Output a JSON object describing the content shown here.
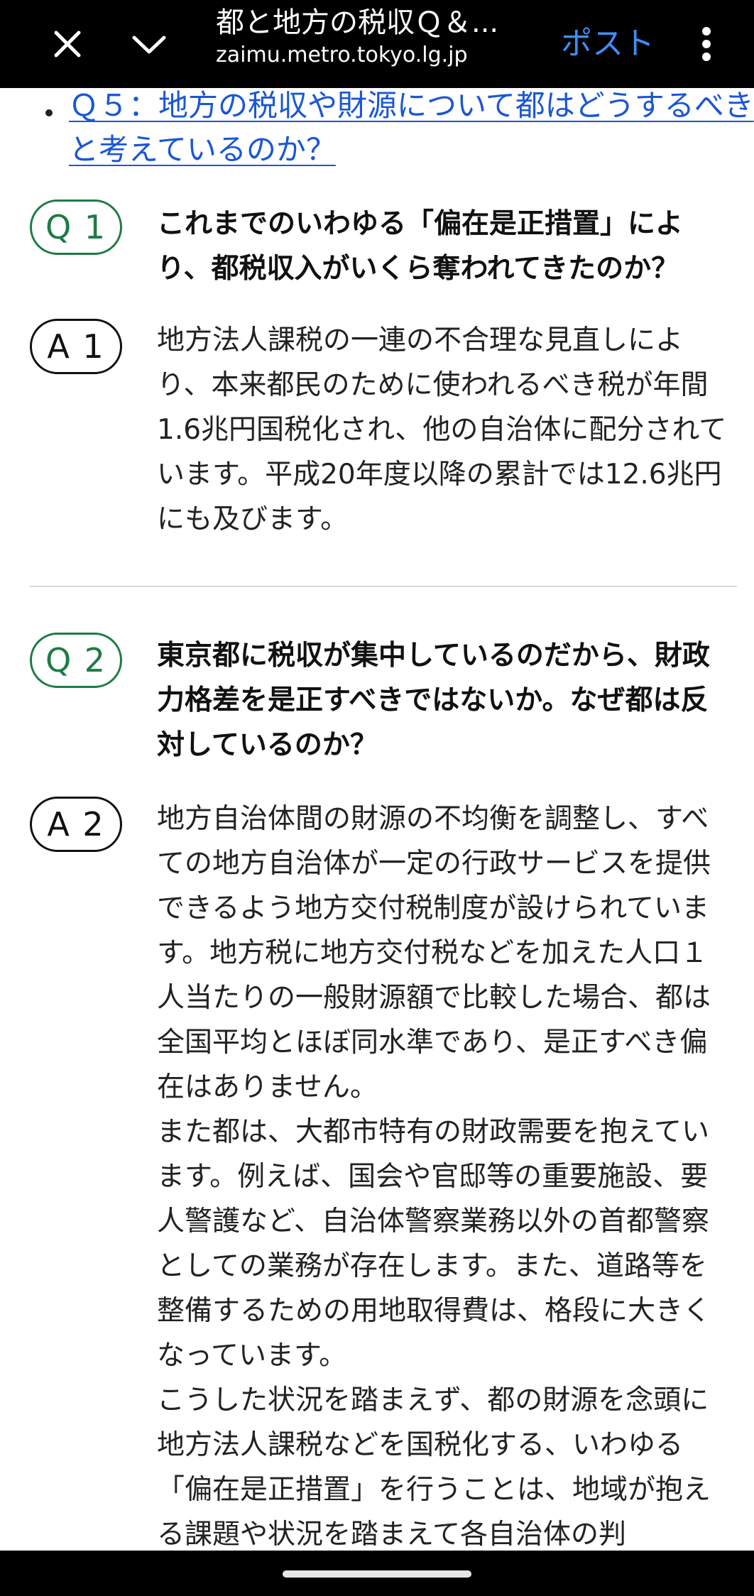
{
  "browser": {
    "title": "都と地方の税収Ｑ＆...",
    "url": "zaimu.metro.tokyo.lg.jp",
    "post_label": "ポスト"
  },
  "toc": {
    "q5_link": "Ｑ５：地方の税収や財源について都はどうするべきと考えているのか？"
  },
  "qa": [
    {
      "q_badge": "Q 1",
      "question": "これまでのいわゆる「偏在是正措置」により、都税収入がいくら奪われてきたのか？",
      "a_badge": "A 1",
      "answer": "地方法人課税の一連の不合理な見直しにより、本来都民のために使われるべき税が年間1.6兆円国税化され、他の自治体に配分されています。平成20年度以降の累計では12.6兆円にも及びます。"
    },
    {
      "q_badge": "Q 2",
      "question": "東京都に税収が集中しているのだから、財政力格差を是正すべきではないか。なぜ都は反対しているのか？",
      "a_badge": "A 2",
      "answer_paragraphs": [
        "地方自治体間の財源の不均衡を調整し、すべての地方自治体が一定の行政サービスを提供できるよう地方交付税制度が設けられています。地方税に地方交付税などを加えた人口１人当たりの一般財源額で比較した場合、都は全国平均とほぼ同水準であり、是正すべき偏在はありません。",
        "また都は、大都市特有の財政需要を抱えています。例えば、国会や官邸等の重要施設、要人警護など、自治体警察業務以外の首都警察としての業務が存在します。また、道路等を整備するための用地取得費は、格段に大きくなっています。",
        "こうした状況を踏まえず、都の財源を念頭に地方法人課税などを国税化する、いわゆる「偏在是正措置」を行うことは、地域が抱える課題や状況を踏まえて各自治体の判"
      ]
    }
  ]
}
